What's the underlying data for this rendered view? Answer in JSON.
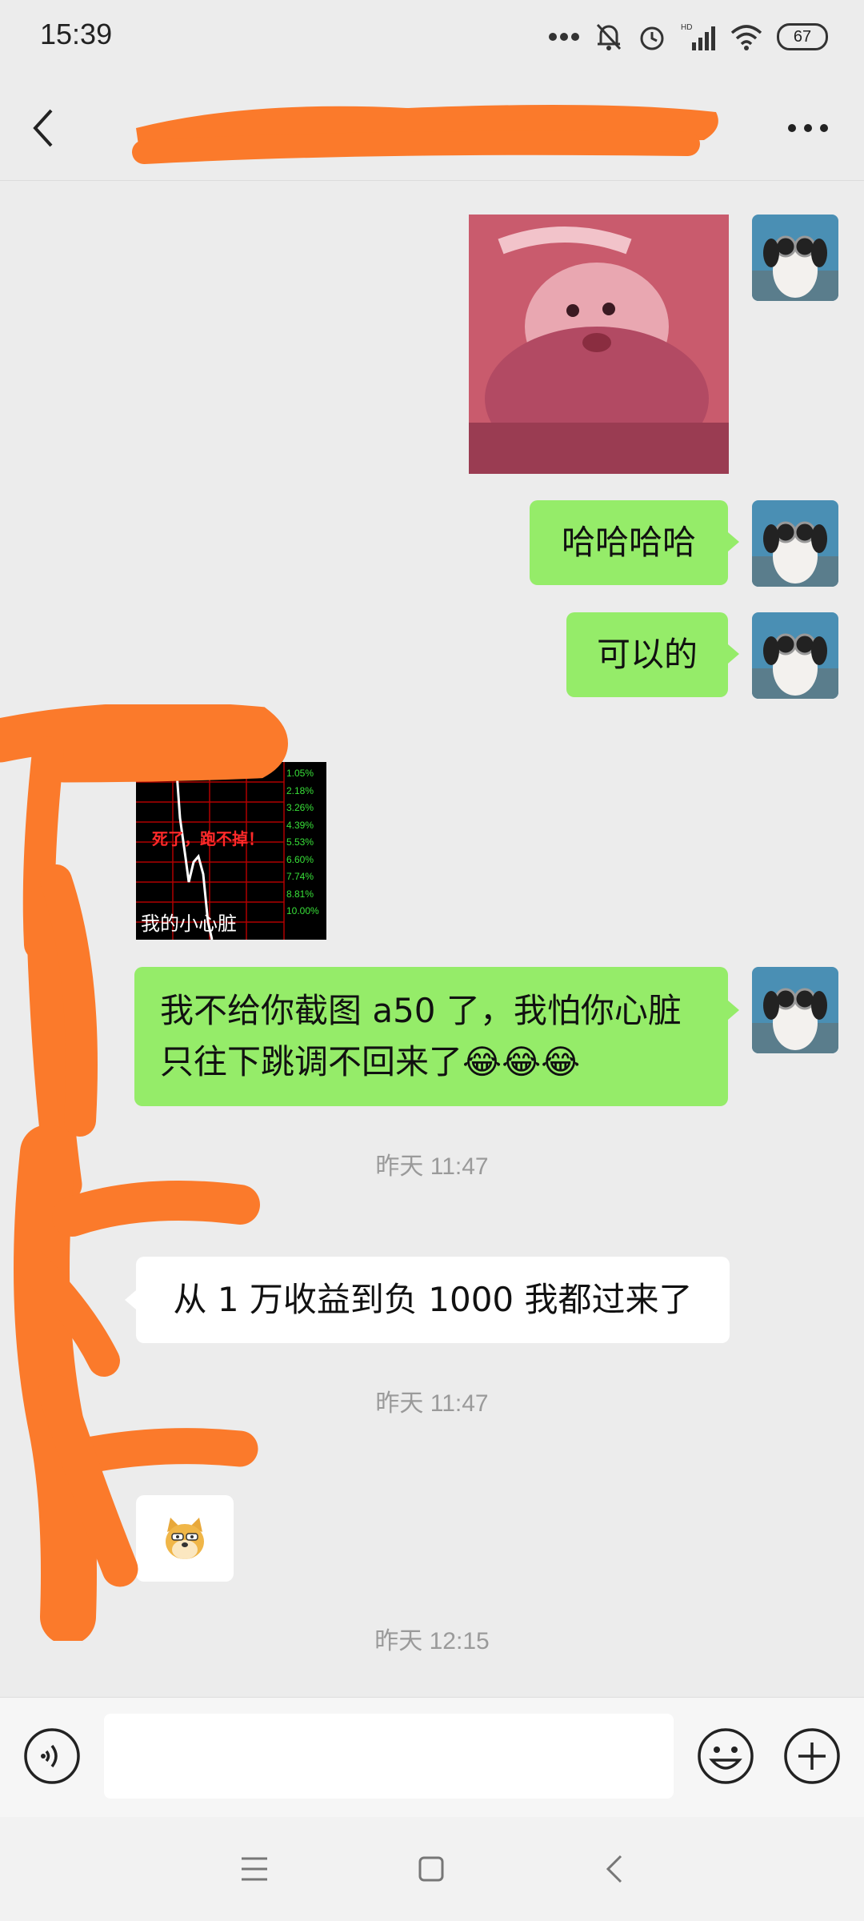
{
  "status_bar": {
    "time": "15:39",
    "battery": "67"
  },
  "header": {
    "title": ""
  },
  "messages": {
    "m2": "哈哈哈哈",
    "m3": "可以的",
    "sticker_text": {
      "red": "死了，跑不掉！",
      "caption": "我的小心脏",
      "percents": [
        "1.05%",
        "2.18%",
        "3.26%",
        "4.39%",
        "5.53%",
        "6.60%",
        "7.74%",
        "8.81%",
        "10.00%"
      ]
    },
    "m5_line1": "我不给你截图 a50 了，我怕你心脏",
    "m5_line2": "只往下跳调不回来了😂😂😂",
    "time1": "昨天 11:47",
    "m6": "从 1 万收益到负 1000 我都过来了",
    "time2": "昨天 11:47",
    "time3": "昨天 12:15"
  },
  "colors": {
    "my_bubble": "#95ec69",
    "redaction": "#fb7a2b"
  }
}
